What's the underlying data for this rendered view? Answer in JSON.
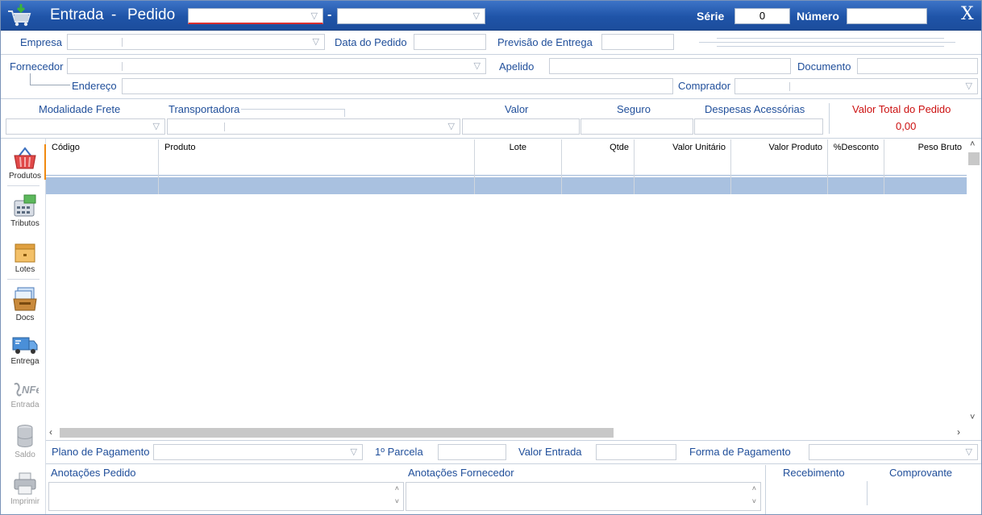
{
  "window": {
    "title": "Entrada",
    "title_sep": "-",
    "subtitle": "Pedido",
    "combo_dash": "-",
    "serie_label": "Série",
    "serie_value": "0",
    "numero_label": "Número",
    "numero_value": "",
    "close_glyph": "X"
  },
  "header": {
    "empresa_label": "Empresa",
    "data_pedido_label": "Data do Pedido",
    "previsao_label": "Previsão de Entrega",
    "fornecedor_label": "Fornecedor",
    "apelido_label": "Apelido",
    "documento_label": "Documento",
    "endereco_label": "Endereço",
    "comprador_label": "Comprador"
  },
  "freight": {
    "modalidade_label": "Modalidade Frete",
    "transportadora_label": "Transportadora",
    "valor_label": "Valor",
    "seguro_label": "Seguro",
    "despesas_label": "Despesas Acessórias",
    "total_label": "Valor Total do Pedido",
    "total_value": "0,00"
  },
  "grid": {
    "columns": [
      "Código",
      "Produto",
      "Lote",
      "Qtde",
      "Valor Unitário",
      "Valor Produto",
      "%Desconto",
      "Peso Bruto"
    ]
  },
  "sidebar": {
    "items": [
      {
        "label": "Produtos",
        "icon": "basket-icon",
        "enabled": true
      },
      {
        "label": "Tributos",
        "icon": "calculator-icon",
        "enabled": true
      },
      {
        "label": "Lotes",
        "icon": "box-icon",
        "enabled": true
      },
      {
        "label": "Docs",
        "icon": "documents-icon",
        "enabled": true
      },
      {
        "label": "Entrega",
        "icon": "truck-icon",
        "enabled": true
      },
      {
        "label": "Entrada",
        "icon": "nfe-icon",
        "enabled": false
      },
      {
        "label": "Saldo",
        "icon": "cylinder-icon",
        "enabled": false
      },
      {
        "label": "Imprimir",
        "icon": "printer-icon",
        "enabled": false
      }
    ]
  },
  "footer": {
    "plano_label": "Plano de Pagamento",
    "parcela_label": "1º Parcela",
    "valor_entrada_label": "Valor Entrada",
    "forma_label": "Forma de Pagamento",
    "anotacoes_pedido_label": "Anotações Pedido",
    "anotacoes_fornecedor_label": "Anotações Fornecedor",
    "recebimento_label": "Recebimento",
    "comprovante_label": "Comprovante"
  },
  "colors": {
    "titlebar": "#1f54a8",
    "label_blue": "#1f4e9a",
    "total_red": "#cc1010",
    "selected_row": "#a9c1e0"
  }
}
